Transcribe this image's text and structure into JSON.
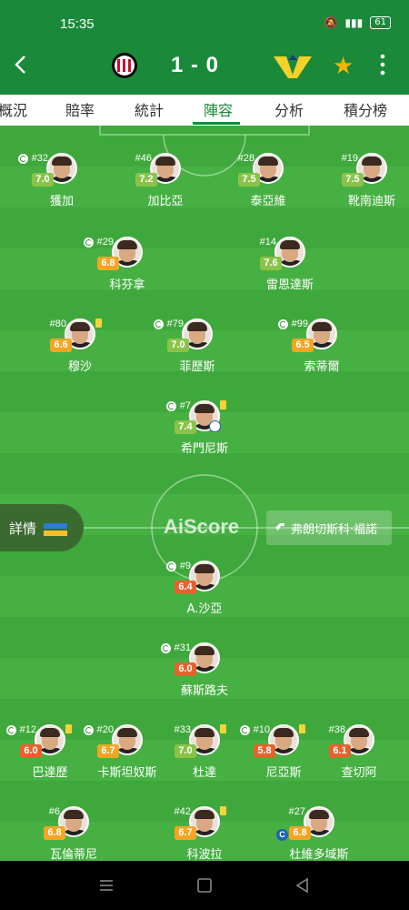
{
  "status_bar": {
    "time": "15:35",
    "battery": "61"
  },
  "match": {
    "home_team": "AC Milan",
    "away_team": "Verona",
    "score": "1 - 0",
    "colors": {
      "primary": "#1a8a3a",
      "home": "#c8102e",
      "away": "#f5d12a"
    }
  },
  "tabs": [
    "概況",
    "賠率",
    "統計",
    "陣容",
    "分析",
    "積分榜"
  ],
  "active_tab": "陣容",
  "home_lineup": [
    {
      "number": "#32",
      "rating": "7.0",
      "name": "獲加",
      "sub": true,
      "yellow": false,
      "rating_color": "#8bc34a"
    },
    {
      "number": "#46",
      "rating": "7.2",
      "name": "加比亞",
      "sub": false,
      "yellow": false,
      "rating_color": "#8bc34a"
    },
    {
      "number": "#28",
      "rating": "7.5",
      "name": "泰亞維",
      "sub": false,
      "yellow": false,
      "rating_color": "#8bc34a"
    },
    {
      "number": "#19",
      "rating": "7.5",
      "name": "靴南迪斯",
      "sub": false,
      "yellow": false,
      "rating_color": "#8bc34a"
    },
    {
      "number": "#29",
      "rating": "6.8",
      "name": "科芬拿",
      "sub": true,
      "yellow": false,
      "rating_color": "#f4a522"
    },
    {
      "number": "#14",
      "rating": "7.6",
      "name": "雷恩達斯",
      "sub": false,
      "yellow": false,
      "rating_color": "#8bc34a"
    },
    {
      "number": "#80",
      "rating": "6.6",
      "name": "穆沙",
      "sub": false,
      "yellow": true,
      "rating_color": "#f4a522"
    },
    {
      "number": "#79",
      "rating": "7.0",
      "name": "菲歷斯",
      "sub": true,
      "yellow": false,
      "rating_color": "#8bc34a"
    },
    {
      "number": "#99",
      "rating": "6.5",
      "name": "索蒂爾",
      "sub": true,
      "yellow": false,
      "rating_color": "#f4a522"
    },
    {
      "number": "#7",
      "rating": "7.4",
      "name": "希門尼斯",
      "sub": true,
      "yellow": true,
      "rating_color": "#8bc34a",
      "goal": true
    }
  ],
  "away_lineup": [
    {
      "number": "#9",
      "rating": "6.4",
      "name": "A.沙亞",
      "sub": true,
      "yellow": false,
      "rating_color": "#e8612c"
    },
    {
      "number": "#31",
      "rating": "6.0",
      "name": "蘇斯路夫",
      "sub": true,
      "yellow": false,
      "rating_color": "#e8612c"
    },
    {
      "number": "#12",
      "rating": "6.0",
      "name": "巴達歷",
      "sub": true,
      "yellow": true,
      "rating_color": "#e8612c"
    },
    {
      "number": "#20",
      "rating": "6.7",
      "name": "卡斯坦奴斯",
      "sub": true,
      "yellow": false,
      "rating_color": "#f4a522"
    },
    {
      "number": "#33",
      "rating": "7.0",
      "name": "杜達",
      "sub": false,
      "yellow": true,
      "rating_color": "#8bc34a"
    },
    {
      "number": "#10",
      "rating": "5.8",
      "name": "尼亞斯",
      "sub": true,
      "yellow": true,
      "rating_color": "#e8612c"
    },
    {
      "number": "#38",
      "rating": "6.1",
      "name": "查切阿",
      "sub": false,
      "yellow": false,
      "rating_color": "#e8612c"
    },
    {
      "number": "#6",
      "rating": "6.8",
      "name": "瓦倫蒂尼",
      "sub": false,
      "yellow": false,
      "rating_color": "#f4a522"
    },
    {
      "number": "#42",
      "rating": "6.7",
      "name": "科波拉",
      "sub": false,
      "yellow": true,
      "rating_color": "#f4a522"
    },
    {
      "number": "#27",
      "rating": "6.8",
      "name": "杜維多域斯",
      "sub": false,
      "yellow": false,
      "rating_color": "#f4a522",
      "captain": true
    }
  ],
  "details_label": "詳情",
  "watermark": "AiScore",
  "coach": {
    "name": "弗朗切斯科·福諾"
  }
}
